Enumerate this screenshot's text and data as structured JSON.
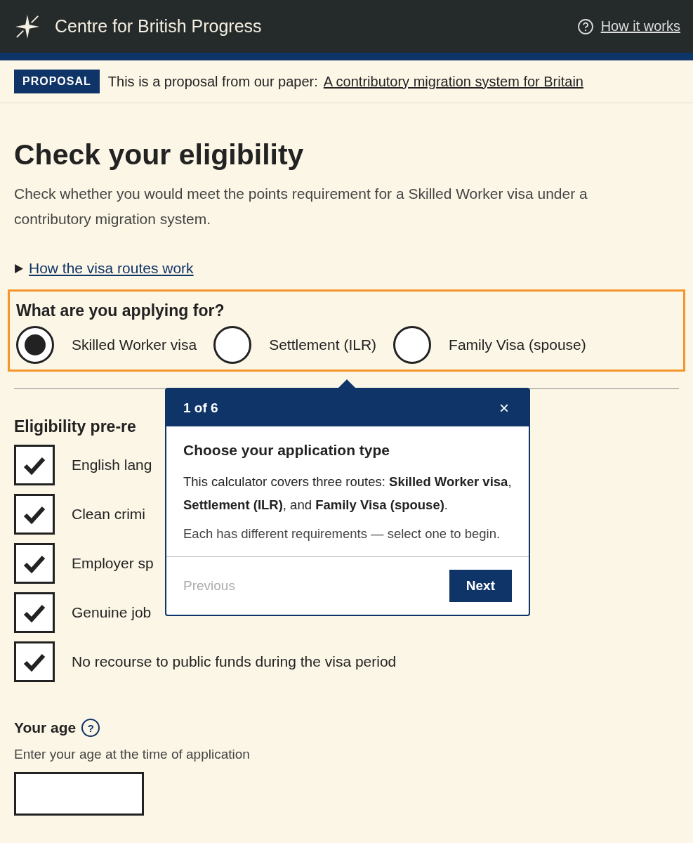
{
  "header": {
    "brand": "Centre for British Progress",
    "help_link": "How it works"
  },
  "banner": {
    "tag": "PROPOSAL",
    "text": "This is a proposal from our paper:",
    "link": "A contributory migration system for Britain"
  },
  "title": "Check your eligibility",
  "intro": "Check whether you would meet the points requirement for a Skilled Worker visa under a contributory migration system.",
  "disclosure": {
    "label": "How the visa routes work",
    "expanded": false
  },
  "application": {
    "question": "What are you applying for?",
    "highlighted": true,
    "options": [
      {
        "label": "Skilled Worker visa",
        "selected": true
      },
      {
        "label": "Settlement (ILR)",
        "selected": false
      },
      {
        "label": "Family Visa (spouse)",
        "selected": false
      }
    ]
  },
  "prerequisites": {
    "heading": "Eligibility pre-re",
    "items": [
      {
        "label": "English lang",
        "checked": true
      },
      {
        "label": "Clean crimi",
        "checked": true
      },
      {
        "label": "Employer sp",
        "checked": true
      },
      {
        "label": "Genuine job",
        "checked": true
      },
      {
        "label": "No recourse to public funds during the visa period",
        "checked": true
      }
    ]
  },
  "age": {
    "label": "Your age",
    "help": "?",
    "hint": "Enter your age at the time of application"
  },
  "tour": {
    "step": "1 of 6",
    "close": "×",
    "title": "Choose your application type",
    "body": "This calculator covers three routes: **Skilled Worker visa**, **Settlement (ILR)**, and **Family Visa (spouse)**.",
    "note": "Each has different requirements — select one to begin.",
    "previous": {
      "label": "Previous",
      "disabled": true
    },
    "next": "Next"
  }
}
